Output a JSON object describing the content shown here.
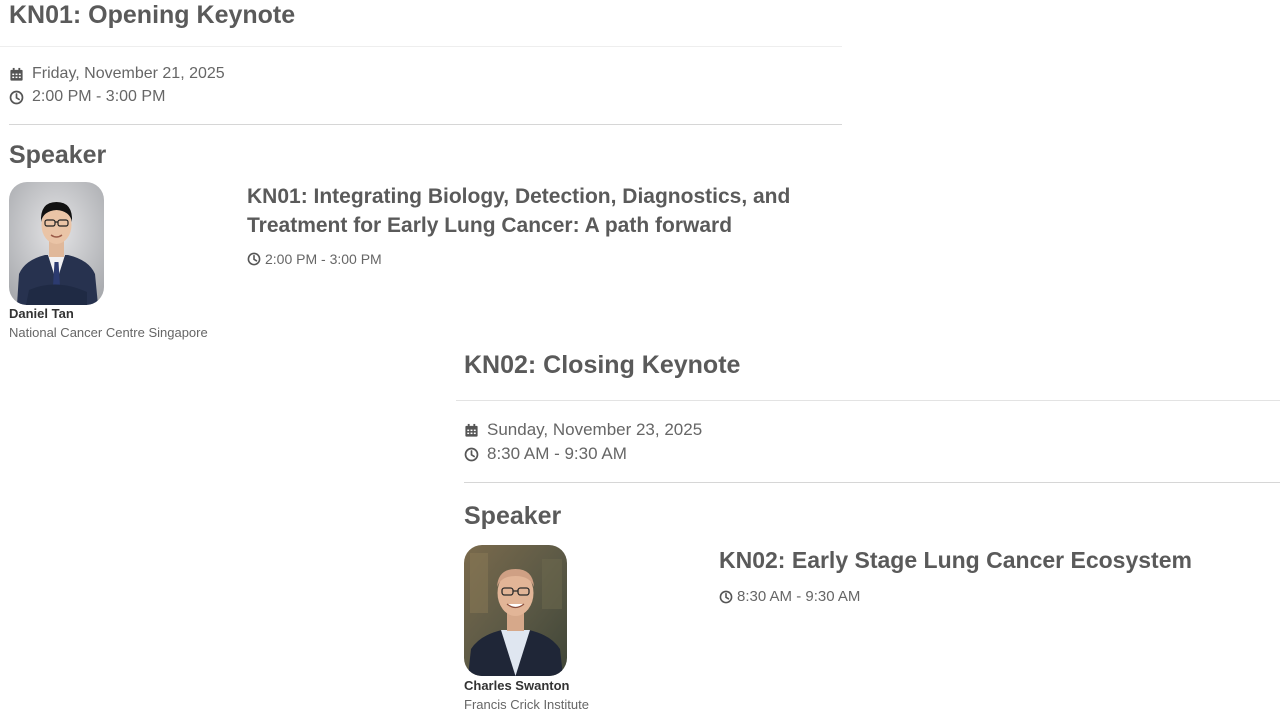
{
  "sessions": [
    {
      "title": "KN01: Opening Keynote",
      "date": "Friday, November 21, 2025",
      "time": "2:00 PM - 3:00 PM",
      "speaker_heading": "Speaker",
      "speaker_name": "Daniel Tan",
      "speaker_org": "National Cancer Centre Singapore",
      "talk_title": "KN01: Integrating Biology, Detection, Diagnostics, and Treatment for Early Lung Cancer: A path forward",
      "talk_time": "2:00 PM - 3:00 PM",
      "icons": {
        "date": "calendar-icon",
        "time": "clock-icon"
      }
    },
    {
      "title": "KN02: Closing Keynote",
      "date": "Sunday, November 23, 2025",
      "time": "8:30 AM - 9:30 AM",
      "speaker_heading": "Speaker",
      "speaker_name": "Charles Swanton",
      "speaker_org": "Francis Crick Institute",
      "talk_title": "KN02: Early Stage Lung Cancer Ecosystem",
      "talk_time": "8:30 AM - 9:30 AM",
      "icons": {
        "date": "calendar-icon",
        "time": "clock-icon"
      }
    }
  ],
  "colors": {
    "heading": "#5a5a5a",
    "meta": "#666666",
    "rule": "#d6d6d6"
  }
}
